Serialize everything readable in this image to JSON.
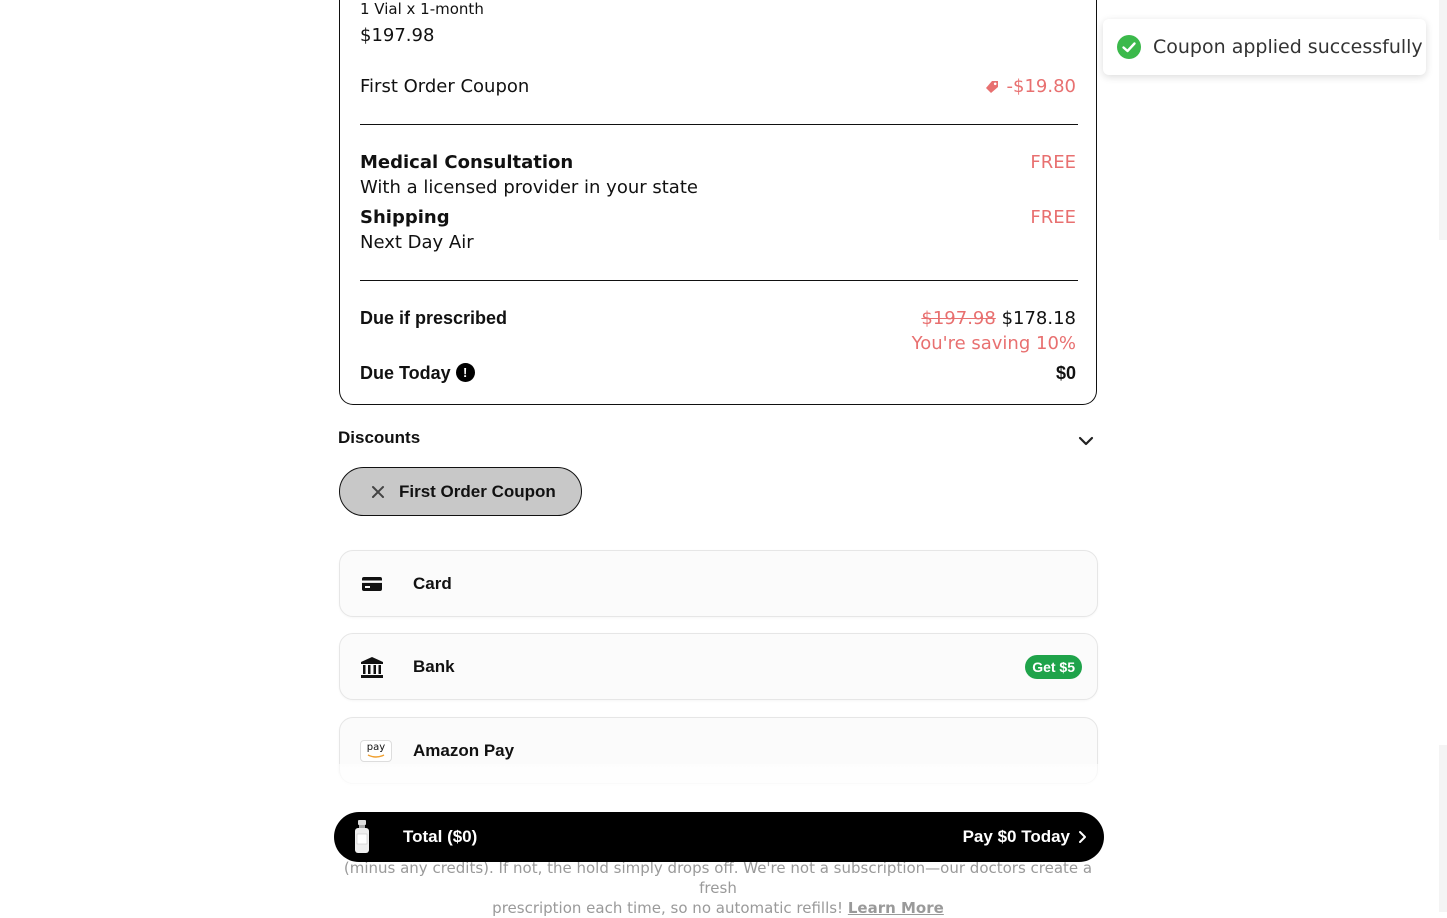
{
  "order": {
    "plan_line": "1 Vial x 1-month",
    "plan_price": "$197.98",
    "coupon_label": "First Order Coupon",
    "coupon_amount": "-$19.80",
    "consultation": {
      "title": "Medical Consultation",
      "subtitle": "With a licensed provider in your state",
      "price": "FREE"
    },
    "shipping": {
      "title": "Shipping",
      "subtitle": "Next Day Air",
      "price": "FREE"
    },
    "due_if_prescribed": {
      "label": "Due if prescribed",
      "original_price": "$197.98",
      "price": "$178.18",
      "saving": "You're saving 10%"
    },
    "due_today": {
      "label": "Due Today",
      "info": "!",
      "price": "$0"
    }
  },
  "discounts": {
    "header": "Discounts",
    "chip_label": "First Order Coupon"
  },
  "payment_methods": [
    {
      "label": "Card",
      "icon": "credit-card-icon"
    },
    {
      "label": "Bank",
      "icon": "bank-icon",
      "badge": "Get $5"
    },
    {
      "label": "Amazon Pay",
      "icon": "amazon-pay-icon",
      "icon_text": "pay"
    }
  ],
  "footer": {
    "line1": "(minus any credits). If not, the hold simply drops off. We're not a subscription—our doctors create a fresh",
    "line2": "prescription each time, so no automatic refills!",
    "link": "Learn More"
  },
  "checkout_bar": {
    "total_label": "Total ($0)",
    "cta_label": "Pay $0 Today"
  },
  "toast": {
    "message": "Coupon applied successfully"
  },
  "colors": {
    "accent_red": "#e87070",
    "badge_green": "#1fa34a",
    "toast_green": "#3bb94b",
    "bar_black": "#000000"
  }
}
